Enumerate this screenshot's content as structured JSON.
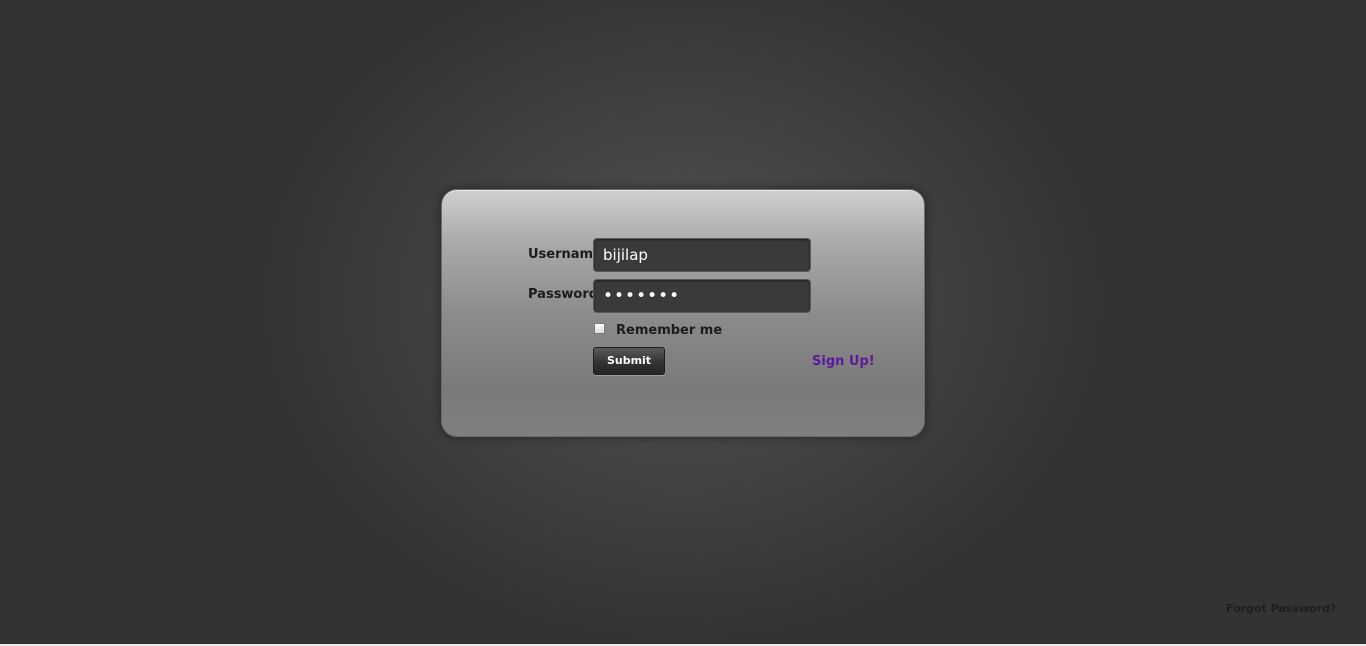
{
  "login_form": {
    "username_label": "Username",
    "username_value": "bijilap",
    "password_label": "Password",
    "password_value": "•••••••",
    "remember_label": "Remember me",
    "remember_checked": false,
    "submit_label": "Submit",
    "signup_label": "Sign Up!"
  },
  "footer": {
    "forgot_password_label": "Forgot Password?"
  },
  "colors": {
    "background": "#333333",
    "signup_link": "#5b1a9c",
    "input_background": "#3a3a3a"
  }
}
